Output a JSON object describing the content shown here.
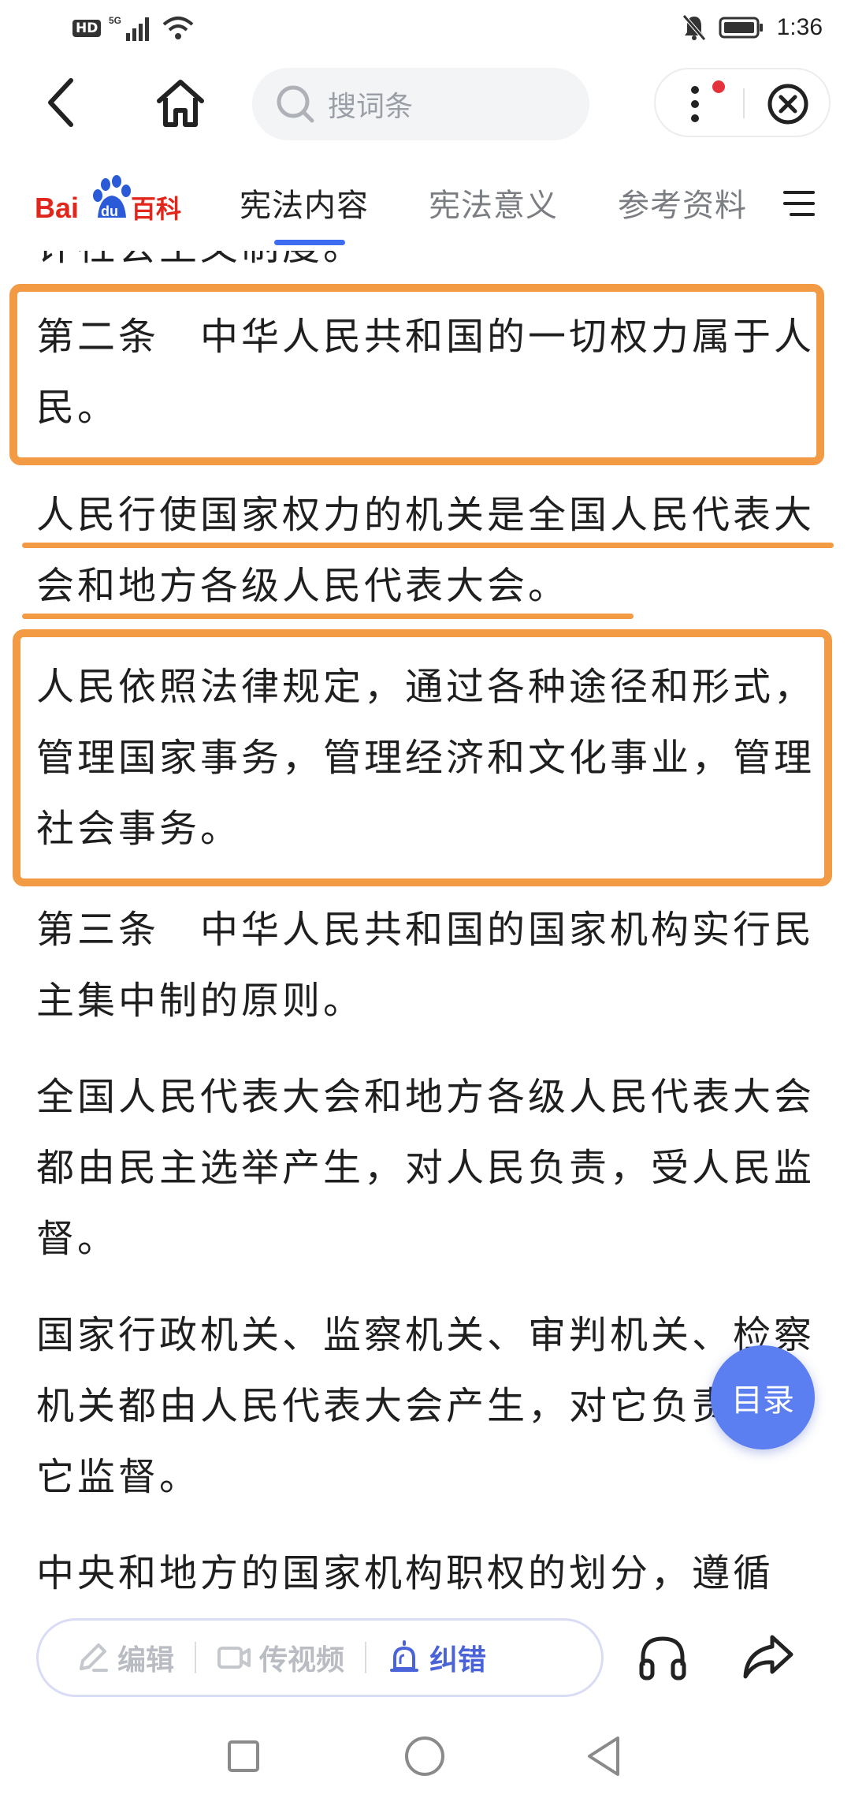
{
  "status_bar": {
    "badge": "HD",
    "network": "5G",
    "time": "1:36"
  },
  "header": {
    "search_placeholder": "搜词条"
  },
  "logo": {
    "text_a": "Bai",
    "text_b": "du",
    "text_c": "百科"
  },
  "tabs": [
    {
      "label": "宪法内容",
      "active": true
    },
    {
      "label": "宪法意义",
      "active": false
    },
    {
      "label": "参考资料",
      "active": false
    }
  ],
  "article": {
    "cut_line": "计社会主义制度。",
    "paragraphs": [
      "第二条　中华人民共和国的一切权力属于人民。",
      "人民行使国家权力的机关是全国人民代表大会和地方各级人民代表大会。",
      "人民依照法律规定，通过各种途径和形式，管理国家事务，管理经济和文化事业，管理社会事务。",
      "第三条　中华人民共和国的国家机构实行民主集中制的原则。",
      "全国人民代表大会和地方各级人民代表大会都由民主选举产生，对人民负责，受人民监督。",
      "国家行政机关、监察机关、审判机关、检察机关都由人民代表大会产生，对它负责，受它监督。",
      "中央和地方的国家机构职权的划分，遵循"
    ]
  },
  "toc_button": "目录",
  "toolbar": {
    "edit": "编辑",
    "video": "传视频",
    "report": "纠错"
  },
  "colors": {
    "accent": "#3d6cf0",
    "highlight": "#f39a44",
    "toc": "#5b7ef0"
  }
}
